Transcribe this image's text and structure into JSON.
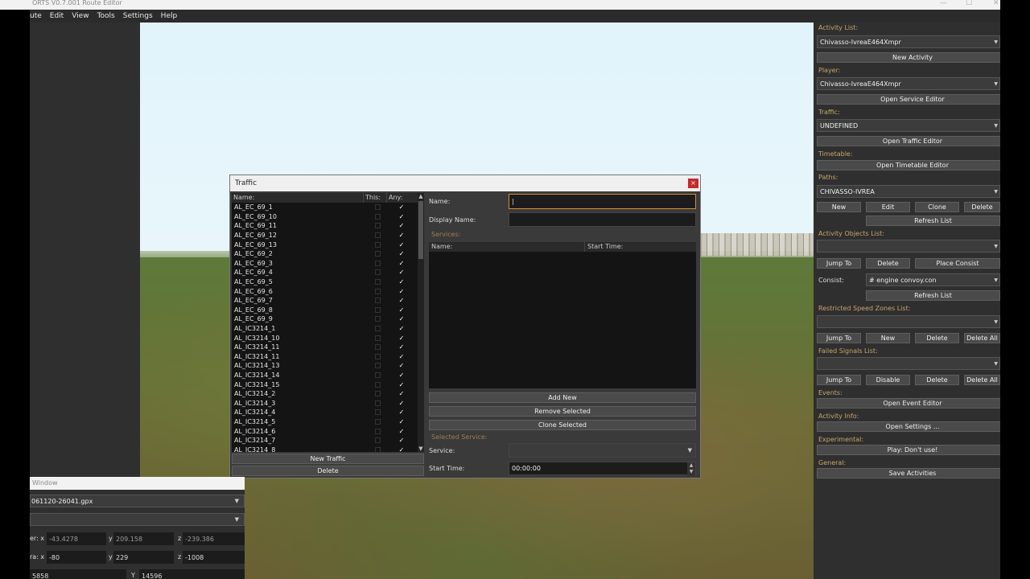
{
  "window": {
    "title": "ORTS V0.7.001 Route Editor",
    "min": "—",
    "max": "☐",
    "close": "✕"
  },
  "menu": [
    "ute",
    "Edit",
    "View",
    "Tools",
    "Settings",
    "Help"
  ],
  "traffic_dialog": {
    "title": "Traffic",
    "close": "×",
    "list_headers": {
      "name": "Name:",
      "this": "This:",
      "any": "Any:"
    },
    "items": [
      "AL_EC_69_1",
      "AL_EC_69_10",
      "AL_EC_69_11",
      "AL_EC_69_12",
      "AL_EC_69_13",
      "AL_EC_69_2",
      "AL_EC_69_3",
      "AL_EC_69_4",
      "AL_EC_69_5",
      "AL_EC_69_6",
      "AL_EC_69_7",
      "AL_EC_69_8",
      "AL_EC_69_9",
      "AL_IC3214_1",
      "AL_IC3214_10",
      "AL_IC3214_11",
      "AL_IC3214_11",
      "AL_IC3214_13",
      "AL_IC3214_14",
      "AL_IC3214_15",
      "AL_IC3214_2",
      "AL_IC3214_3",
      "AL_IC3214_4",
      "AL_IC3214_5",
      "AL_IC3214_6",
      "AL_IC3214_7",
      "AL_IC3214_8"
    ],
    "check_mark": "✓",
    "scroll_up": "▲",
    "scroll_down": "▼",
    "new_traffic": "New Traffic",
    "delete": "Delete",
    "name_label": "Name:",
    "name_value": "",
    "display_name_label": "Display Name:",
    "display_name_value": "",
    "services_label": "Services:",
    "services_headers": {
      "name": "Name:",
      "start_time": "Start Time:"
    },
    "add_new": "Add New",
    "remove_selected": "Remove Selected",
    "clone_selected": "Clone Selected",
    "selected_service_label": "Selected Service:",
    "service_label": "Service:",
    "service_value": "",
    "start_time_label": "Start Time:",
    "start_time_value": "00:00:00",
    "dropdown_arrow": "▼",
    "spin_up": "▲",
    "spin_down": "▼"
  },
  "right_panel": {
    "activity_list_label": "Activity List:",
    "activity_value": "Chivasso-IvreaE464Xmpr",
    "new_activity": "New Activity",
    "player_label": "Player:",
    "player_value": "Chivasso-IvreaE464Xmpr",
    "open_service_editor": "Open Service Editor",
    "traffic_label": "Traffic:",
    "traffic_value": "UNDEFINED",
    "open_traffic_editor": "Open Traffic Editor",
    "timetable_label": "Timetable:",
    "open_timetable_editor": "Open Timetable Editor",
    "paths_label": "Paths:",
    "paths_value": "CHIVASSO-IVREA",
    "new": "New",
    "edit": "Edit",
    "clone": "Clone",
    "delete": "Delete",
    "refresh_list": "Refresh List",
    "activity_objects_label": "Activity Objects List:",
    "activity_objects_value": "",
    "jump_to": "Jump To",
    "place_consist": "Place Consist",
    "consist_label": "Consist:",
    "consist_value": "# engine convoy.con",
    "restricted_speed_label": "Restricted Speed Zones List:",
    "restricted_value": "",
    "delete_all": "Delete All",
    "failed_signals_label": "Failed Signals List:",
    "failed_signals_value": "",
    "disable": "Disable",
    "events_label": "Events:",
    "open_event_editor": "Open Event Editor",
    "activity_info_label": "Activity Info:",
    "open_settings": "Open Settings ...",
    "experimental_label": "Experimental:",
    "play_dont_use": "Play: Don't use!",
    "general_label": "General:",
    "save_activities": "Save Activities",
    "dropdown_arrow": "▼"
  },
  "bottom_window": {
    "title": "Window",
    "gpx_value": "061120-26041.gpx",
    "second_value": "",
    "row1_label": "er: x",
    "row1_x": "-43.4278",
    "row1_y_label": "y",
    "row1_y": "209.158",
    "row1_z_label": "z",
    "row1_z": "-239.386",
    "row2_label": "ra: x",
    "row2_x": "-80",
    "row2_y_label": "y",
    "row2_y": "229",
    "row2_z_label": "z",
    "row2_z": "-1008",
    "row3_a": "5858",
    "row3_y_label": "Y",
    "row3_y": "14596",
    "dropdown_arrow": "▼"
  }
}
